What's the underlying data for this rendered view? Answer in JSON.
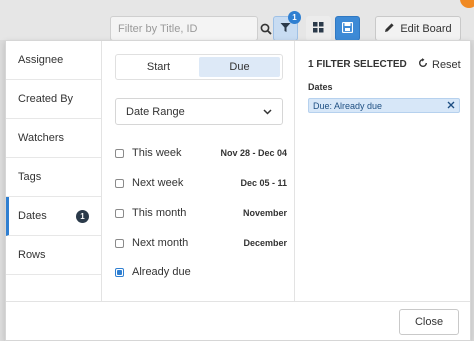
{
  "toolbar": {
    "search_placeholder": "Filter by Title, ID",
    "filter_count": "1",
    "edit_board_label": "Edit Board"
  },
  "sidebar": {
    "items": [
      {
        "label": "Assignee"
      },
      {
        "label": "Created By"
      },
      {
        "label": "Watchers"
      },
      {
        "label": "Tags"
      },
      {
        "label": "Dates",
        "badge": "1"
      },
      {
        "label": "Rows"
      }
    ]
  },
  "middle": {
    "segments": [
      "Start",
      "Due"
    ],
    "dropdown_value": "Date Range",
    "options": [
      {
        "label": "This week",
        "date": "Nov 28 - Dec 04"
      },
      {
        "label": "Next week",
        "date": "Dec 05 - 11"
      },
      {
        "label": "This month",
        "date": "November"
      },
      {
        "label": "Next month",
        "date": "December"
      },
      {
        "label": "Already due",
        "date": ""
      }
    ]
  },
  "right": {
    "title": "1 FILTER SELECTED",
    "reset_label": "Reset",
    "section_label": "Dates",
    "chip_label": "Due: Already due"
  },
  "footer": {
    "close_label": "Close"
  },
  "colors": {
    "accent": "#2f7fd1",
    "chip_bg": "#d7e7f8",
    "segment_active_bg": "#dde9f7"
  }
}
